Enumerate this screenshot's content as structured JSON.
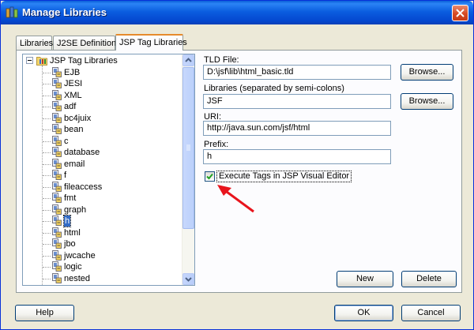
{
  "window": {
    "title": "Manage Libraries",
    "close_icon": "close-icon",
    "accent_color": "#0054e3"
  },
  "tabs": [
    {
      "label": "Libraries",
      "active": false
    },
    {
      "label": "J2SE Definitions",
      "active": false
    },
    {
      "label": "JSP Tag Libraries",
      "active": true
    }
  ],
  "tree": {
    "root": {
      "label": "JSP Tag Libraries",
      "expanded": true,
      "icon": "folder-library-icon"
    },
    "items": [
      "EJB",
      "JESI",
      "XML",
      "adf",
      "bc4juix",
      "bean",
      "c",
      "database",
      "email",
      "f",
      "fileaccess",
      "fmt",
      "graph",
      "h",
      "html",
      "jbo",
      "jwcache",
      "logic",
      "nested"
    ],
    "selected": "h",
    "item_icon": "tag-library-icon"
  },
  "form": {
    "tld_label": "TLD File:",
    "tld_value": "D:\\jsf\\lib\\html_basic.tld",
    "libraries_label": "Libraries (separated by semi-colons)",
    "libraries_value": "JSF",
    "uri_label": "URI:",
    "uri_value": "http://java.sun.com/jsf/html",
    "prefix_label": "Prefix:",
    "prefix_value": "h",
    "execute_label": "Execute Tags in JSP Visual Editor",
    "execute_checked": true,
    "browse_label": "Browse...",
    "new_label": "New",
    "delete_label": "Delete"
  },
  "footer": {
    "help_label": "Help",
    "ok_label": "OK",
    "cancel_label": "Cancel"
  },
  "annotation": {
    "arrow_color": "#e8141c"
  }
}
